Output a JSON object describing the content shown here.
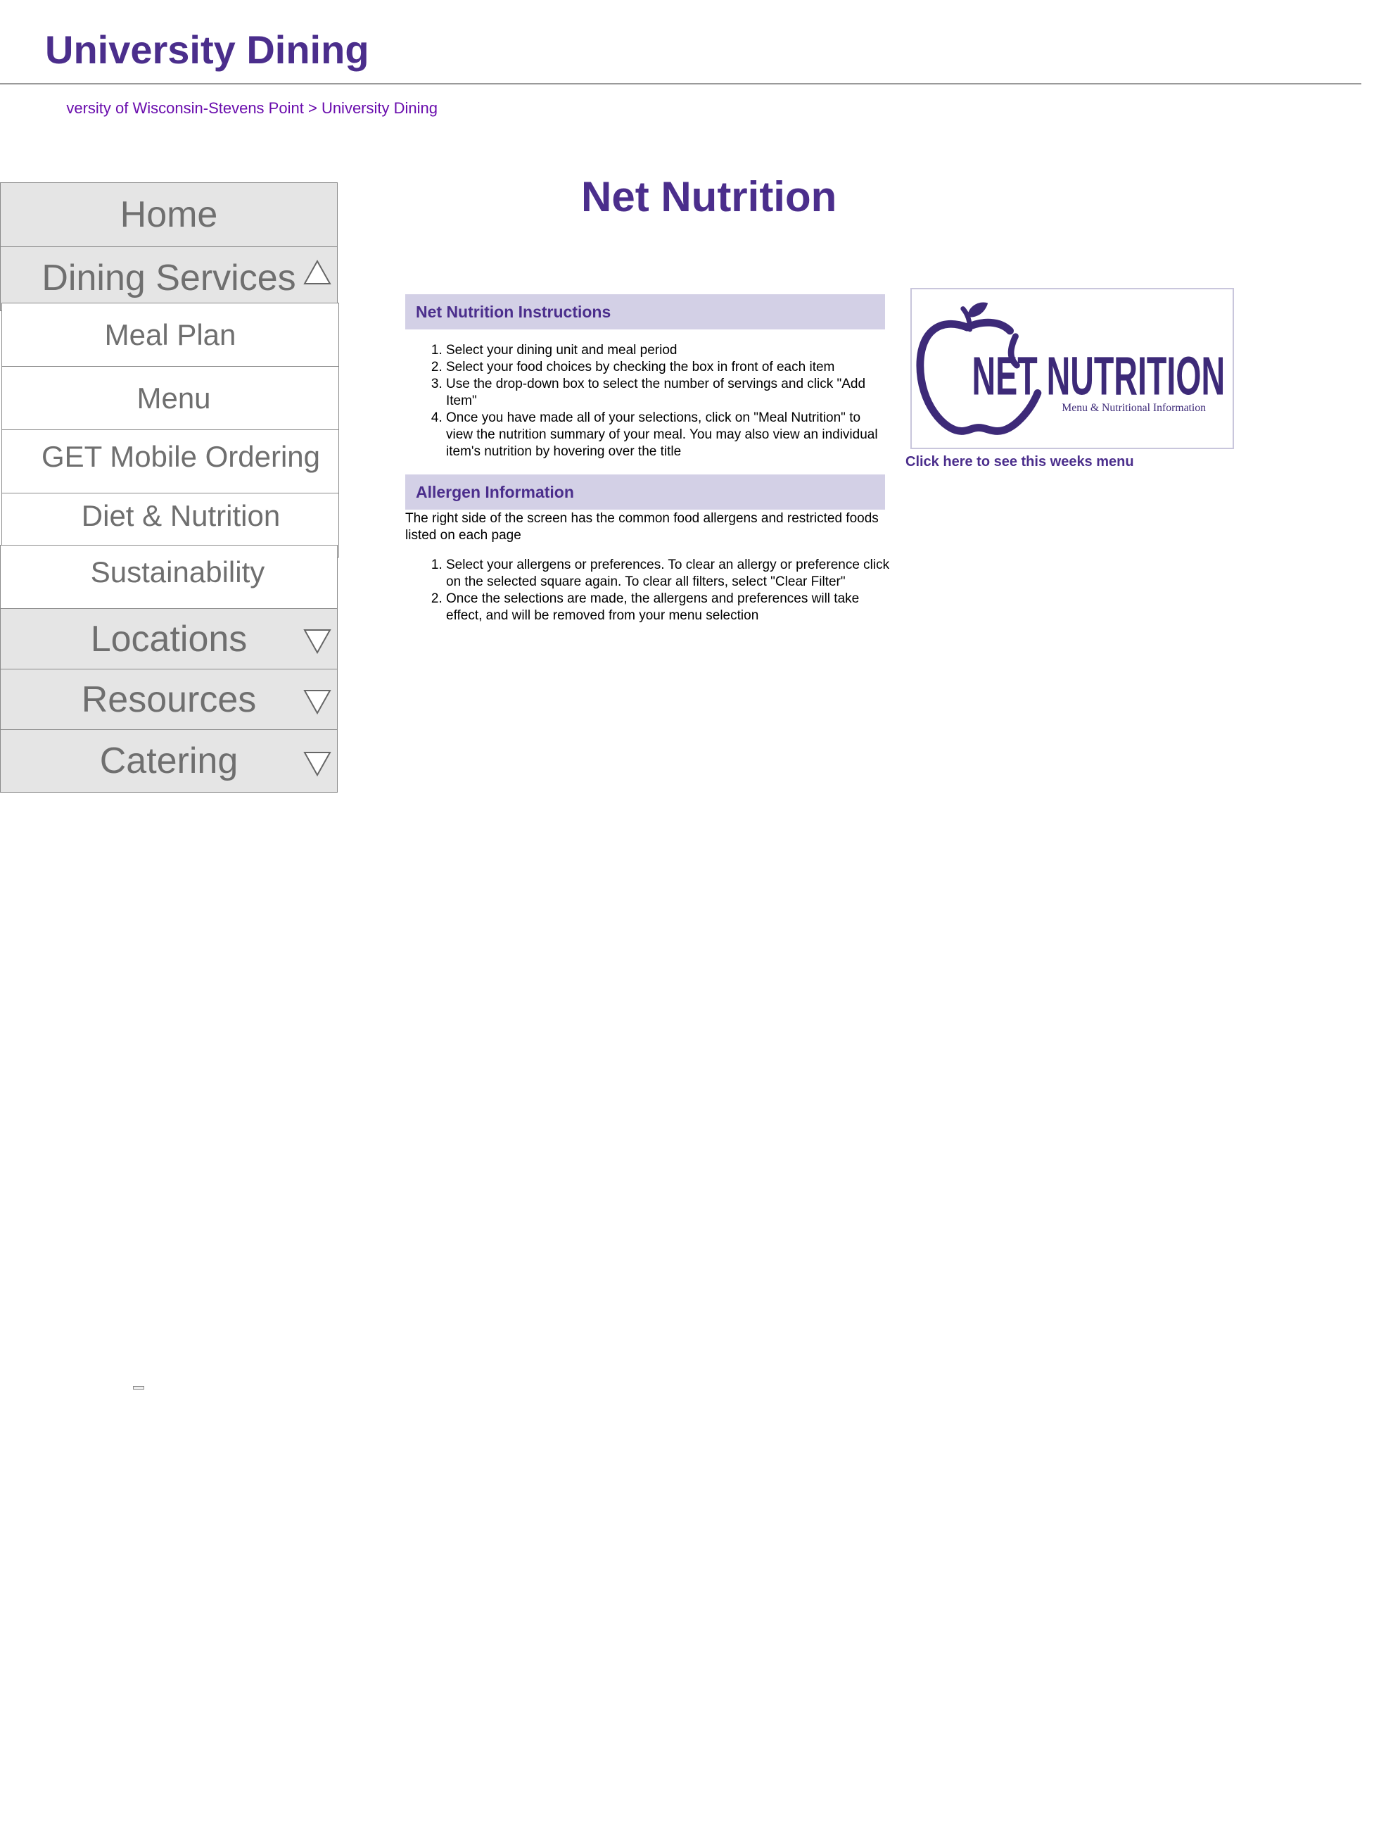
{
  "header": {
    "title": "University Dining"
  },
  "breadcrumb": {
    "parent": "versity of Wisconsin-Stevens Point",
    "separator": ">",
    "current": "University Dining"
  },
  "sidebar": {
    "items": [
      {
        "label": "Home"
      },
      {
        "label": "Dining Services",
        "expanded": true
      },
      {
        "label": "Meal Plan"
      },
      {
        "label": "Menu"
      },
      {
        "label": "GET Mobile Ordering"
      },
      {
        "label": "Diet & Nutrition"
      },
      {
        "label": "Sustainability"
      },
      {
        "label": "Locations",
        "expanded": false
      },
      {
        "label": "Resources",
        "expanded": false
      },
      {
        "label": "Catering",
        "expanded": false
      }
    ]
  },
  "main": {
    "title": "Net Nutrition",
    "instructions": {
      "heading": "Net Nutrition Instructions",
      "steps": [
        "Select your dining unit and meal period",
        "Select your food choices by checking the box in front of each item",
        "Use the drop-down box to select the number of servings and click \"Add Item\"",
        "Once you have made all of your selections, click on \"Meal Nutrition\" to view the nutrition summary of your meal. You may also view an individual item's nutrition by hovering over the title"
      ]
    },
    "allergen": {
      "heading": "Allergen Information",
      "intro": "The right side of the screen has the common food allergens and restricted foods listed on each page",
      "steps": [
        "Select your allergens or preferences. To clear an allergy or preference click on the selected square again. To clear all filters, select \"Clear Filter\"",
        "Once the selections are made, the allergens and preferences will take effect, and will be removed from your menu selection"
      ]
    },
    "logo": {
      "wordmark": "NET NUTRITION",
      "tagline": "Menu & Nutritional Information",
      "icon": "apple-icon"
    },
    "menu_link": "Click here to see this weeks menu"
  },
  "colors": {
    "brand_purple": "#4b2e8c",
    "link_purple": "#6a0dad",
    "section_bg": "#d3d0e6",
    "nav_bg": "#e5e5e5",
    "nav_text": "#6f6f6f"
  }
}
